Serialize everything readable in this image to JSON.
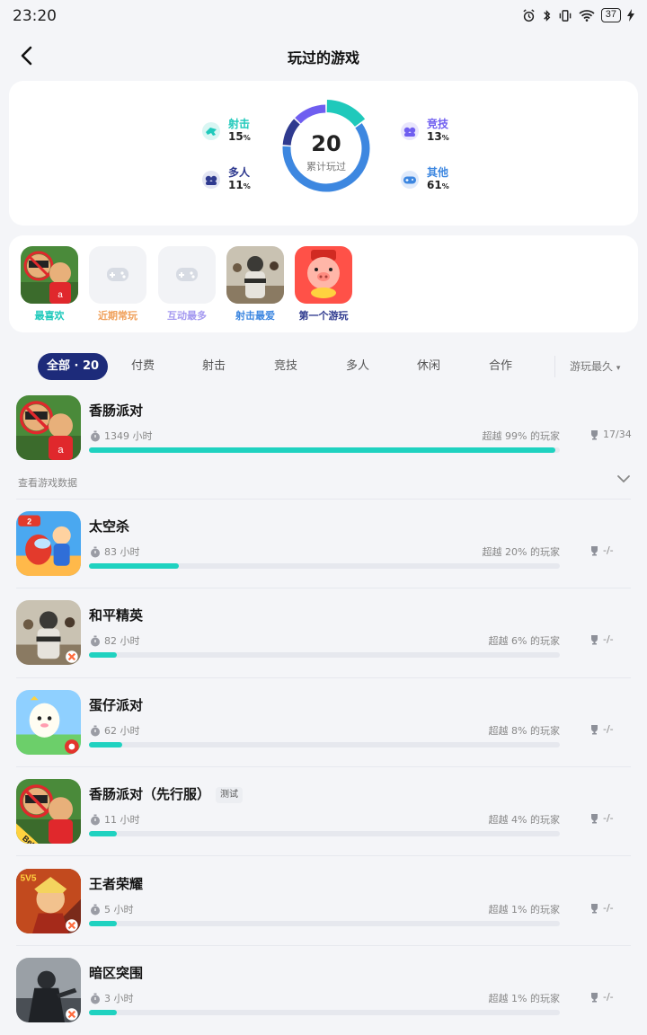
{
  "status_bar": {
    "time": "23:20",
    "battery": "37"
  },
  "header": {
    "title": "玩过的游戏"
  },
  "stats": {
    "total": "20",
    "total_label": "累计玩过",
    "categories": [
      {
        "name": "射击",
        "percent": "15",
        "unit": "%",
        "color": "#1fc9bb",
        "value": 15
      },
      {
        "name": "多人",
        "percent": "11",
        "unit": "%",
        "color": "#2f3a8f",
        "value": 11
      },
      {
        "name": "竞技",
        "percent": "13",
        "unit": "%",
        "color": "#6f5ef0",
        "value": 13
      },
      {
        "name": "其他",
        "percent": "61",
        "unit": "%",
        "color": "#3d87e0",
        "value": 61
      }
    ]
  },
  "highlights": [
    {
      "label": "最喜欢",
      "color": "#1fc9bb",
      "icon": "sausage-man-thumb"
    },
    {
      "label": "近期常玩",
      "color": "#f0a15c",
      "icon": "gamepad-placeholder-icon"
    },
    {
      "label": "互动最多",
      "color": "#a59af0",
      "icon": "gamepad-placeholder-icon"
    },
    {
      "label": "射击最爱",
      "color": "#3d87e0",
      "icon": "peace-elite-thumb"
    },
    {
      "label": "第一个游玩",
      "color": "#2f3a8f",
      "icon": "pig-thumb"
    }
  ],
  "tabs": [
    "全部 · 20",
    "付费",
    "射击",
    "竞技",
    "多人",
    "休闲",
    "合作"
  ],
  "sort": {
    "label": "游玩最久",
    "arrow": "▾"
  },
  "view_data_label": "查看游戏数据",
  "games": [
    {
      "name": "香肠派对",
      "badge": "",
      "hours": "1349 小时",
      "beat": "超越 99% 的玩家",
      "trophy": "17/34",
      "progress": 0.99,
      "thumb": "sausage-man"
    },
    {
      "name": "太空杀",
      "badge": "",
      "hours": "83 小时",
      "beat": "超越 20% 的玩家",
      "trophy": "-/-",
      "progress": 0.19,
      "thumb": "space-kill"
    },
    {
      "name": "和平精英",
      "badge": "",
      "hours": "82 小时",
      "beat": "超越 6% 的玩家",
      "trophy": "-/-",
      "progress": 0.06,
      "thumb": "peace-elite"
    },
    {
      "name": "蛋仔派对",
      "badge": "",
      "hours": "62 小时",
      "beat": "超越 8% 的玩家",
      "trophy": "-/-",
      "progress": 0.07,
      "thumb": "eggy-party"
    },
    {
      "name": "香肠派对（先行服）",
      "badge": "测试",
      "hours": "11 小时",
      "beat": "超越 4% 的玩家",
      "trophy": "-/-",
      "progress": 0.06,
      "thumb": "sausage-man-beta"
    },
    {
      "name": "王者荣耀",
      "badge": "",
      "hours": "5 小时",
      "beat": "超越 1% 的玩家",
      "trophy": "-/-",
      "progress": 0.06,
      "thumb": "honor-of-kings"
    },
    {
      "name": "暗区突围",
      "badge": "",
      "hours": "3 小时",
      "beat": "超越 1% 的玩家",
      "trophy": "-/-",
      "progress": 0.06,
      "thumb": "arena-breakout"
    }
  ]
}
